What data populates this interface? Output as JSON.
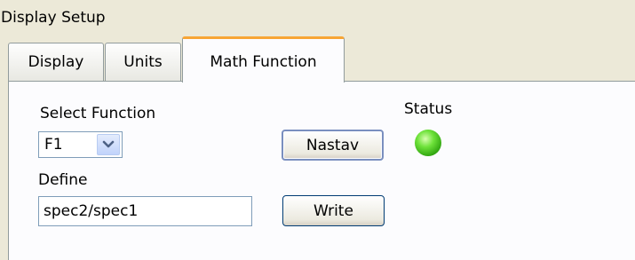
{
  "window": {
    "group_title": "Display Setup"
  },
  "tabs": [
    {
      "label": "Display",
      "active": false
    },
    {
      "label": "Units",
      "active": false
    },
    {
      "label": "Math Function",
      "active": true
    }
  ],
  "math_function": {
    "select_function_label": "Select Function",
    "selected_function": "F1",
    "define_label": "Define",
    "define_value": "spec2/spec1",
    "nastav_label": "Nastav",
    "write_label": "Write",
    "status_label": "Status",
    "status_color": "#4cd21e",
    "dropdown_icon": "chevron-down-icon"
  }
}
